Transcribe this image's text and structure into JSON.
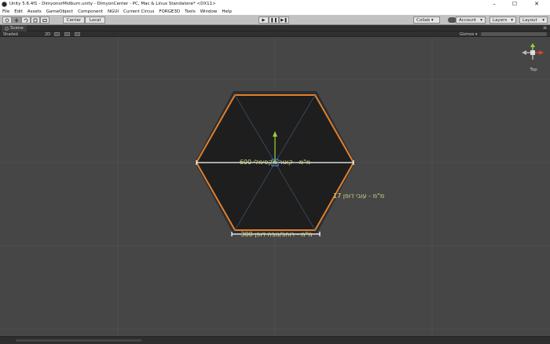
{
  "window": {
    "title": "Unity 5.6.4f1 - DimyonorMidburn.unity - DimyonCenter - PC, Mac & Linux Standalone* <DX11>",
    "minimize": "–",
    "maximize": "☐",
    "close": "✕"
  },
  "menu": {
    "items": [
      "File",
      "Edit",
      "Assets",
      "GameObject",
      "Component",
      "NGUI",
      "Current Circus",
      "FORGE3D",
      "Tools",
      "Window",
      "Help"
    ]
  },
  "toolbar": {
    "pivot_label": "Center",
    "space_label": "Local",
    "play_icon": "▶",
    "pause_icon": "❚❚",
    "step_icon": "▶❚",
    "collab_label": "Collab ▾",
    "account_label": "Account",
    "layers_label": "Layers",
    "layout_label": "Layout",
    "dropdown_arrow": "▾"
  },
  "scene": {
    "tab_label": "Scene",
    "shading_mode": "Shaded",
    "mode_2d": "2D",
    "gizmos_label": "Gizmos ▾",
    "orientation_label": "Top"
  },
  "annotations": {
    "max_diameter": "600 מ\"מ - קוטר מקסימלי",
    "panel_thickness": "17 מ\"מ - עובי דופן",
    "wall_width": "300 מ\"מ - רוחב/גובה דופן"
  },
  "colors": {
    "viewport": "#464646",
    "hexagon_outer": "#2c2d30",
    "hexagon_inner": "#1e1e1e",
    "hexagon_outline": "#e0802c",
    "annotation_text": "#d4d98a",
    "dimension_line": "#ffffff",
    "gizmo_y": "#9bd13c",
    "gizmo_x": "#d3452f"
  }
}
